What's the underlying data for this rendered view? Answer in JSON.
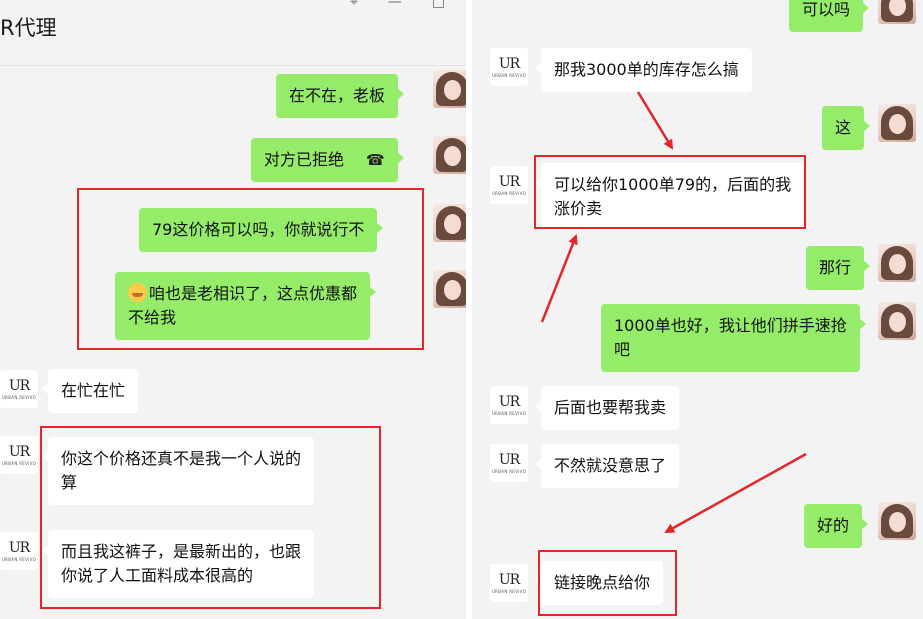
{
  "chat": {
    "title": "R代理",
    "header_icons": [
      "pin-icon",
      "minimize-icon",
      "maximize-icon"
    ],
    "left_messages": [
      {
        "from": "me",
        "text": "在不在，老板"
      },
      {
        "from": "me",
        "text": "对方已拒绝",
        "icon": "phone-icon"
      },
      {
        "from": "me",
        "text": "79这价格可以吗，你就说行不"
      },
      {
        "from": "me",
        "text_line1": "咱也是老相识了，这点优惠都",
        "text_line2": "不给我",
        "icon": "emoji-icon"
      },
      {
        "from": "them",
        "text": "在忙在忙"
      },
      {
        "from": "them",
        "text_line1": "你这个价格还真不是我一个人说的",
        "text_line2": "算"
      },
      {
        "from": "them",
        "text_line1": "而且我这裤子，是最新出的，也跟",
        "text_line2": "你说了人工面料成本很高的"
      }
    ],
    "right_messages": [
      {
        "from": "me",
        "text": "可以吗"
      },
      {
        "from": "them",
        "text": "那我3000单的库存怎么搞"
      },
      {
        "from": "me",
        "text": "这"
      },
      {
        "from": "them",
        "text_line1": "可以给你1000单79的，后面的我",
        "text_line2": "涨价卖"
      },
      {
        "from": "me",
        "text": "那行"
      },
      {
        "from": "me",
        "text_line1": "1000单也好，我让他们拼手速抢",
        "text_line2": "吧"
      },
      {
        "from": "them",
        "text": "后面也要帮我卖"
      },
      {
        "from": "them",
        "text": "不然就没意思了"
      },
      {
        "from": "me",
        "text": "好的"
      },
      {
        "from": "them",
        "text": "链接晚点给你"
      }
    ],
    "brand_avatar": {
      "mark": "UR",
      "sub": "URBAN REVIVO"
    }
  },
  "colors": {
    "outgoing_bubble": "#95ec69",
    "incoming_bubble": "#ffffff",
    "background": "#f3f3f3",
    "highlight": "#e4262b"
  }
}
